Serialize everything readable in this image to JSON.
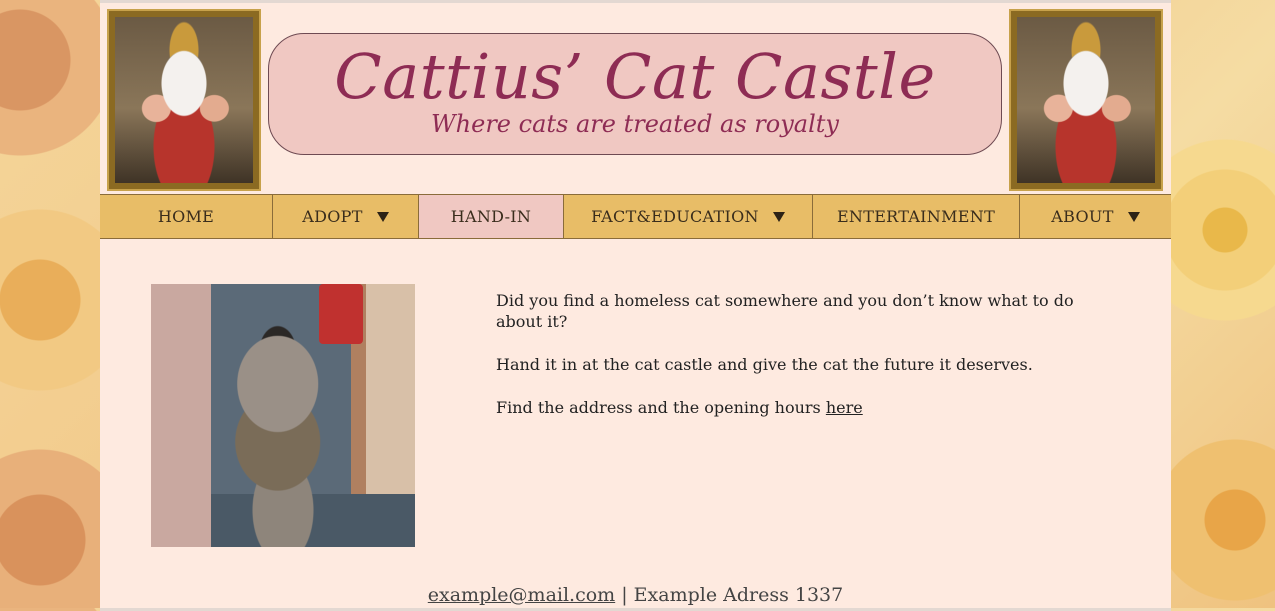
{
  "header": {
    "title": "Cattius’ Cat Castle",
    "tagline": "Where cats are treated as royalty"
  },
  "nav": {
    "items": [
      {
        "label": "HOME",
        "dropdown": false
      },
      {
        "label": "ADOPT",
        "dropdown": true
      },
      {
        "label": "HAND-IN",
        "dropdown": false,
        "active": true
      },
      {
        "label": "FACT&EDUCATION",
        "dropdown": true
      },
      {
        "label": "ENTERTAINMENT",
        "dropdown": false
      },
      {
        "label": "ABOUT",
        "dropdown": true
      }
    ]
  },
  "main": {
    "paragraphs": [
      "Did you find a homeless cat somewhere and you don’t know what to do about it?",
      "Hand it in at the cat castle and give the cat the future it deserves.",
      "Find the address and the opening hours "
    ],
    "link_text": "here"
  },
  "footer": {
    "email": "example@mail.com",
    "separator": " | ",
    "address": "Example Adress 1337"
  },
  "colors": {
    "page_bg": "#feeae0",
    "nav_bg": "#e8bd67",
    "nav_active_bg": "#f0c8c2",
    "title_color": "#8e2c54"
  }
}
